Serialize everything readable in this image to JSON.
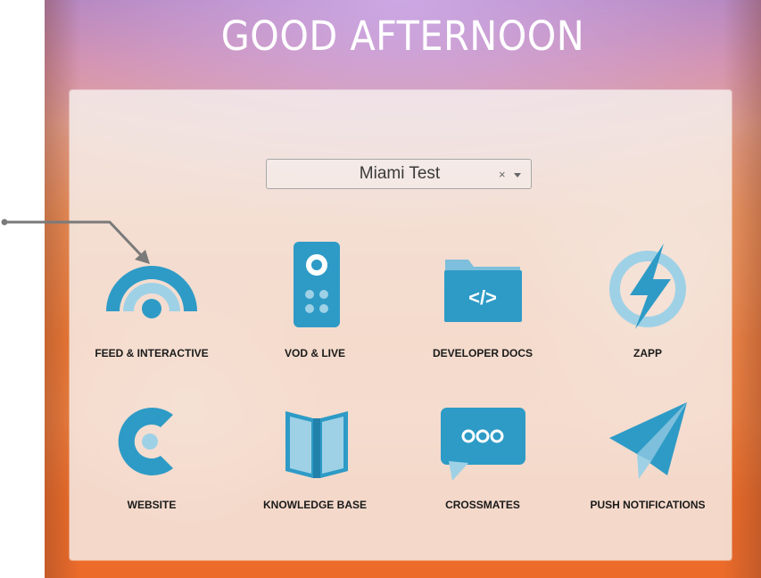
{
  "greeting": "GOOD AFTERNOON",
  "selector": {
    "value": "Miami Test",
    "clear_glyph": "×"
  },
  "tiles": [
    {
      "label": "FEED & INTERACTIVE",
      "icon": "feed-icon"
    },
    {
      "label": "VOD & LIVE",
      "icon": "remote-icon"
    },
    {
      "label": "DEVELOPER DOCS",
      "icon": "code-folder-icon"
    },
    {
      "label": "ZAPP",
      "icon": "lightning-icon"
    },
    {
      "label": "WEBSITE",
      "icon": "c-logo-icon"
    },
    {
      "label": "KNOWLEDGE BASE",
      "icon": "book-icon"
    },
    {
      "label": "CROSSMATES",
      "icon": "chat-bubble-icon"
    },
    {
      "label": "PUSH NOTIFICATIONS",
      "icon": "paper-plane-icon"
    }
  ],
  "colors": {
    "accent": "#2e9bc6",
    "accent_dark": "#2281ab",
    "accent_light": "#9fd1e6"
  }
}
